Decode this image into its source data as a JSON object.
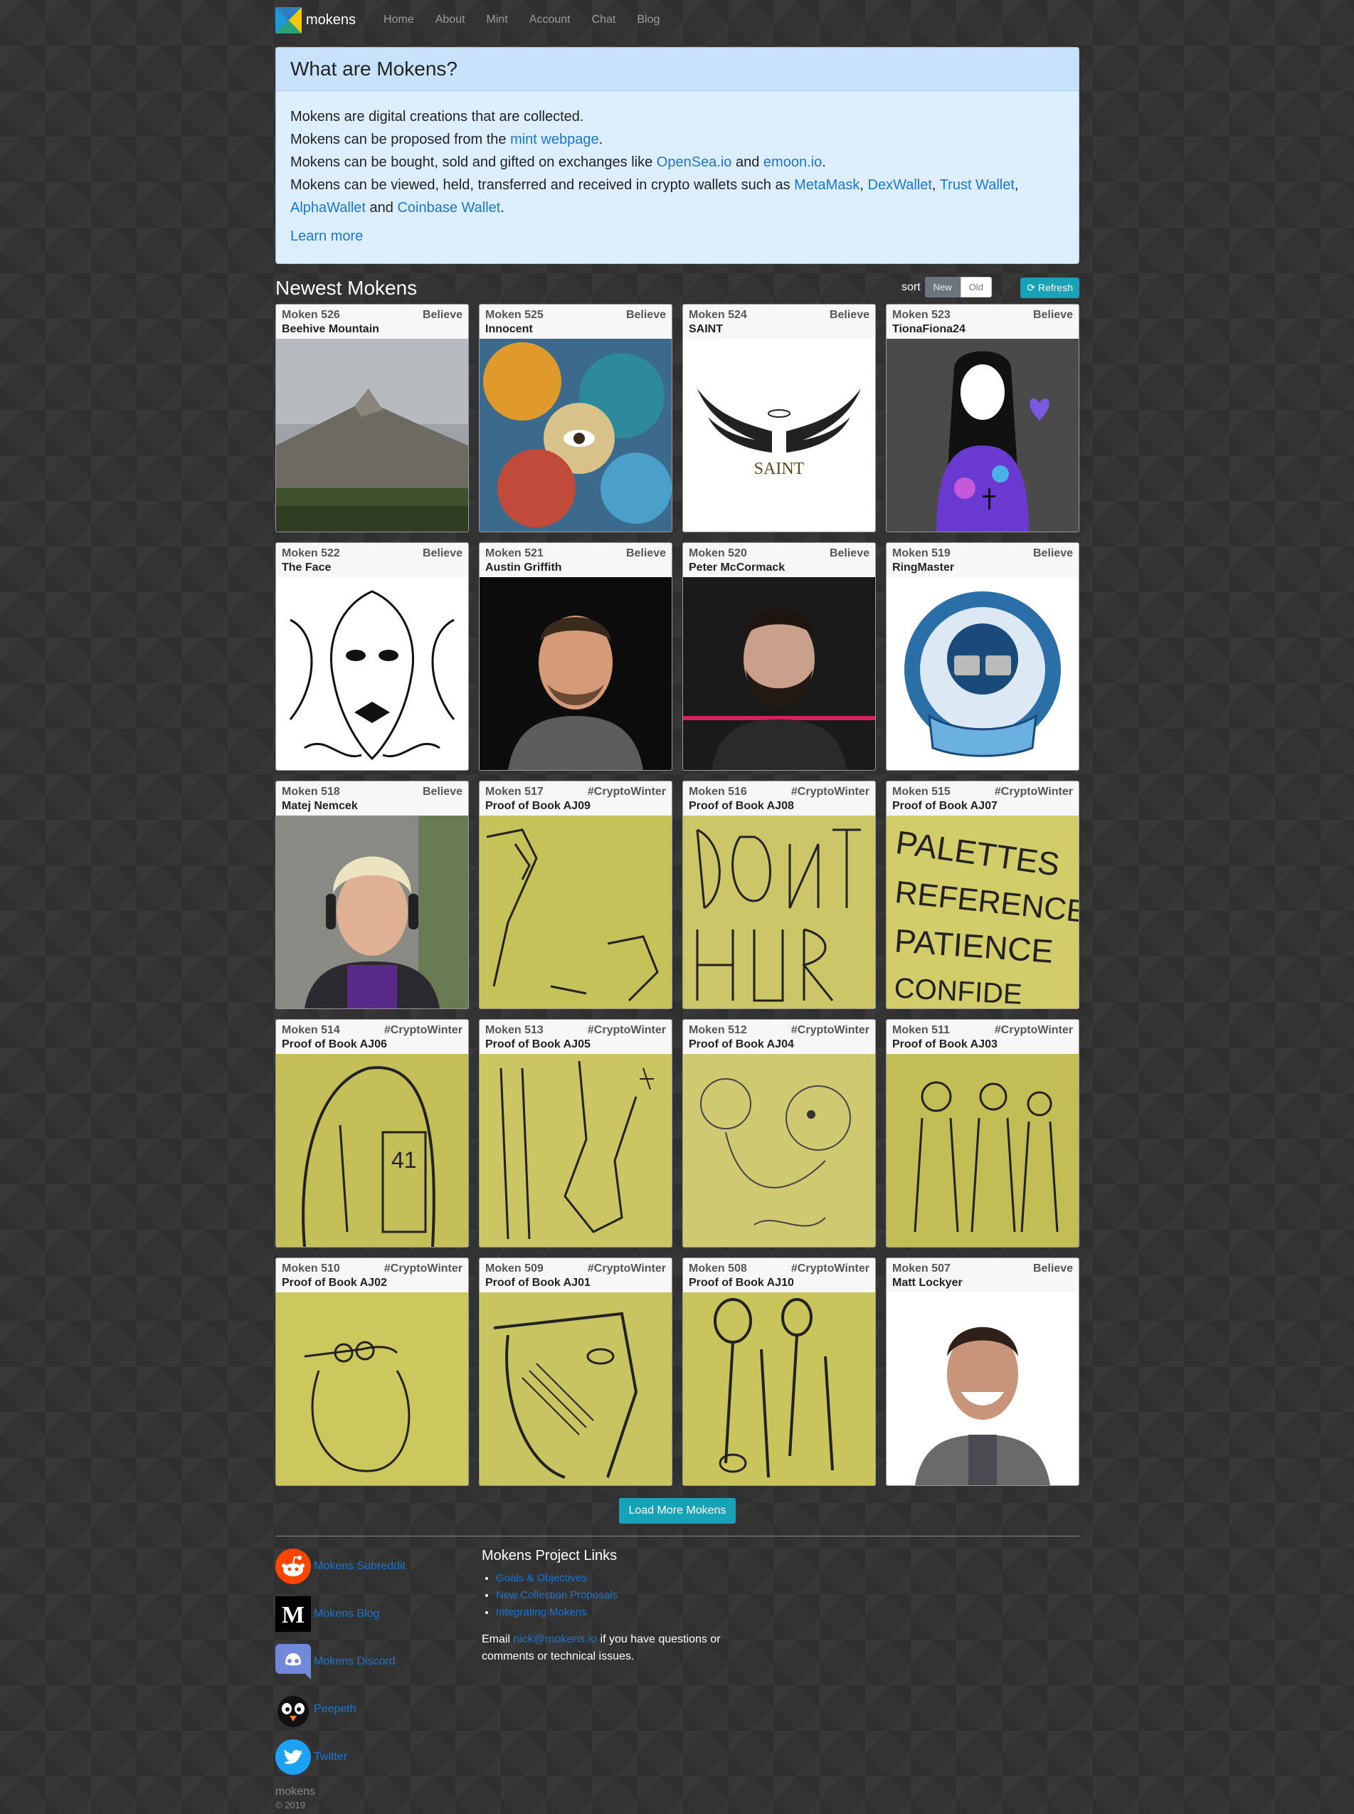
{
  "nav": {
    "brand": "mokens",
    "links": [
      "Home",
      "About",
      "Mint",
      "Account",
      "Chat",
      "Blog"
    ]
  },
  "info": {
    "title": "What are Mokens?",
    "line1": "Mokens are digital creations that are collected.",
    "line2_pre": "Mokens can be proposed from the ",
    "line2_link": "mint webpage",
    "line2_post": ".",
    "line3_pre": "Mokens can be bought, sold and gifted on exchanges like ",
    "line3_link1": "OpenSea.io",
    "line3_mid": " and ",
    "line3_link2": "emoon.io",
    "line3_post": ".",
    "line4_pre": "Mokens can be viewed, held, transferred and received in crypto wallets such as ",
    "line4_w1": "MetaMask",
    "line4_sep1": ", ",
    "line4_w2": "DexWallet",
    "line4_sep2": ", ",
    "line4_w3": "Trust Wallet",
    "line4_sep3": ", ",
    "line4_w4": "AlphaWallet",
    "line4_and": " and ",
    "line4_w5": "Coinbase Wallet",
    "line4_post": ".",
    "learn_more": "Learn more"
  },
  "section": {
    "title": "Newest Mokens",
    "sort_label": "sort",
    "sort_new": "New",
    "sort_old": "Old",
    "refresh": "Refresh"
  },
  "cards": [
    {
      "num": "Moken 526",
      "tag": "Believe",
      "name": "Beehive Mountain"
    },
    {
      "num": "Moken 525",
      "tag": "Believe",
      "name": "Innocent"
    },
    {
      "num": "Moken 524",
      "tag": "Believe",
      "name": "SAINT"
    },
    {
      "num": "Moken 523",
      "tag": "Believe",
      "name": "TionaFiona24"
    },
    {
      "num": "Moken 522",
      "tag": "Believe",
      "name": "The Face"
    },
    {
      "num": "Moken 521",
      "tag": "Believe",
      "name": "Austin Griffith"
    },
    {
      "num": "Moken 520",
      "tag": "Believe",
      "name": "Peter McCormack"
    },
    {
      "num": "Moken 519",
      "tag": "Believe",
      "name": "RingMaster"
    },
    {
      "num": "Moken 518",
      "tag": "Believe",
      "name": "Matej Nemcek"
    },
    {
      "num": "Moken 517",
      "tag": "#CryptoWinter",
      "name": "Proof of Book AJ09"
    },
    {
      "num": "Moken 516",
      "tag": "#CryptoWinter",
      "name": "Proof of Book AJ08"
    },
    {
      "num": "Moken 515",
      "tag": "#CryptoWinter",
      "name": "Proof of Book AJ07"
    },
    {
      "num": "Moken 514",
      "tag": "#CryptoWinter",
      "name": "Proof of Book AJ06"
    },
    {
      "num": "Moken 513",
      "tag": "#CryptoWinter",
      "name": "Proof of Book AJ05"
    },
    {
      "num": "Moken 512",
      "tag": "#CryptoWinter",
      "name": "Proof of Book AJ04"
    },
    {
      "num": "Moken 511",
      "tag": "#CryptoWinter",
      "name": "Proof of Book AJ03"
    },
    {
      "num": "Moken 510",
      "tag": "#CryptoWinter",
      "name": "Proof of Book AJ02"
    },
    {
      "num": "Moken 509",
      "tag": "#CryptoWinter",
      "name": "Proof of Book AJ01"
    },
    {
      "num": "Moken 508",
      "tag": "#CryptoWinter",
      "name": "Proof of Book AJ10"
    },
    {
      "num": "Moken 507",
      "tag": "Believe",
      "name": "Matt Lockyer"
    }
  ],
  "load_more": "Load More Mokens",
  "footer": {
    "social": [
      {
        "label": "Mokens Subreddit",
        "icon": "reddit-icon"
      },
      {
        "label": "Mokens Blog",
        "icon": "medium-icon"
      },
      {
        "label": "Mokens Discord",
        "icon": "discord-icon"
      },
      {
        "label": "Peepeth",
        "icon": "peepeth-icon"
      },
      {
        "label": "Twitter",
        "icon": "twitter-icon"
      }
    ],
    "links_title": "Mokens Project Links",
    "links": [
      "Goals & Objectives",
      "New Collection Proposals",
      "Integrating Mokens"
    ],
    "email_pre": "Email ",
    "email_link": "nick@mokens.io",
    "email_post": " if you have questions or comments or technical issues.",
    "copy_name": "mokens",
    "copy_year": "© 2019"
  },
  "colors": {
    "background": "#333333",
    "link": "#1b76d2",
    "info_bg": "#ddeeff",
    "info_head": "#c9e2fb",
    "teal_button": "#17a2b8",
    "paper_yellow": "#c6c25a"
  }
}
